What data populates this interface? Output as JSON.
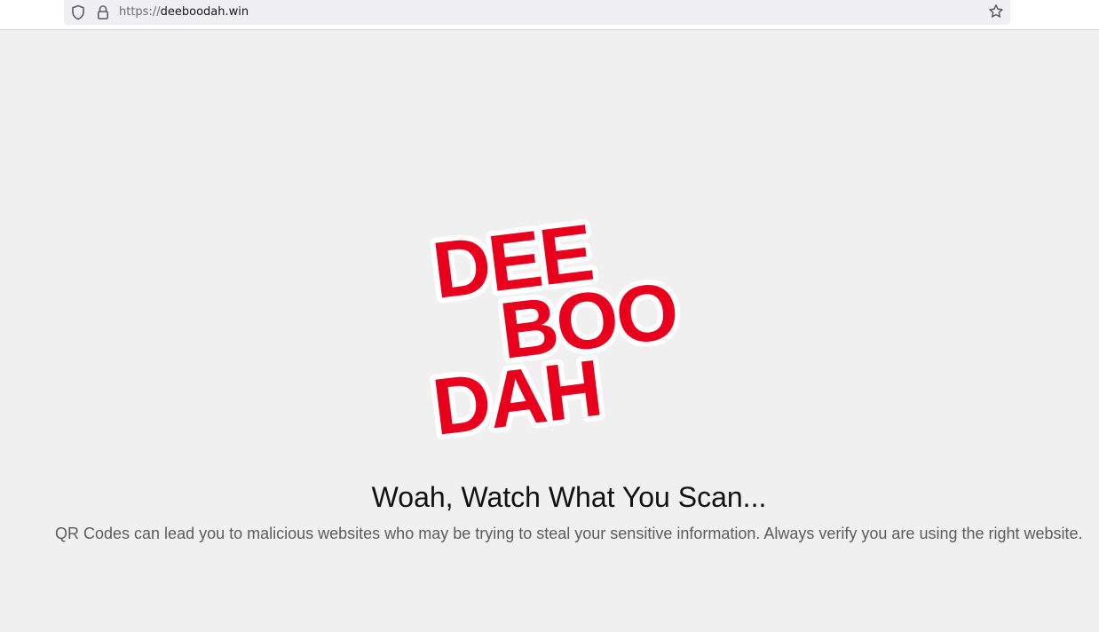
{
  "browser": {
    "url_scheme": "https://",
    "url_host": "deeboodah.win",
    "icons": {
      "tracking_protection": "shield-icon",
      "connection": "lock-icon",
      "bookmark": "star-icon"
    }
  },
  "logo": {
    "line1": "DEE",
    "line2": "BOO",
    "line3": "DAH",
    "color": "#e8001c",
    "outline": "#ffffff"
  },
  "page": {
    "headline": "Woah, Watch What You Scan...",
    "message": "QR Codes can lead you to malicious websites who may be trying to steal your sensitive information. Always verify you are using the right website."
  },
  "colors": {
    "background": "#f0f0f0",
    "text_main": "#111111",
    "text_secondary": "#5c5c5c"
  }
}
